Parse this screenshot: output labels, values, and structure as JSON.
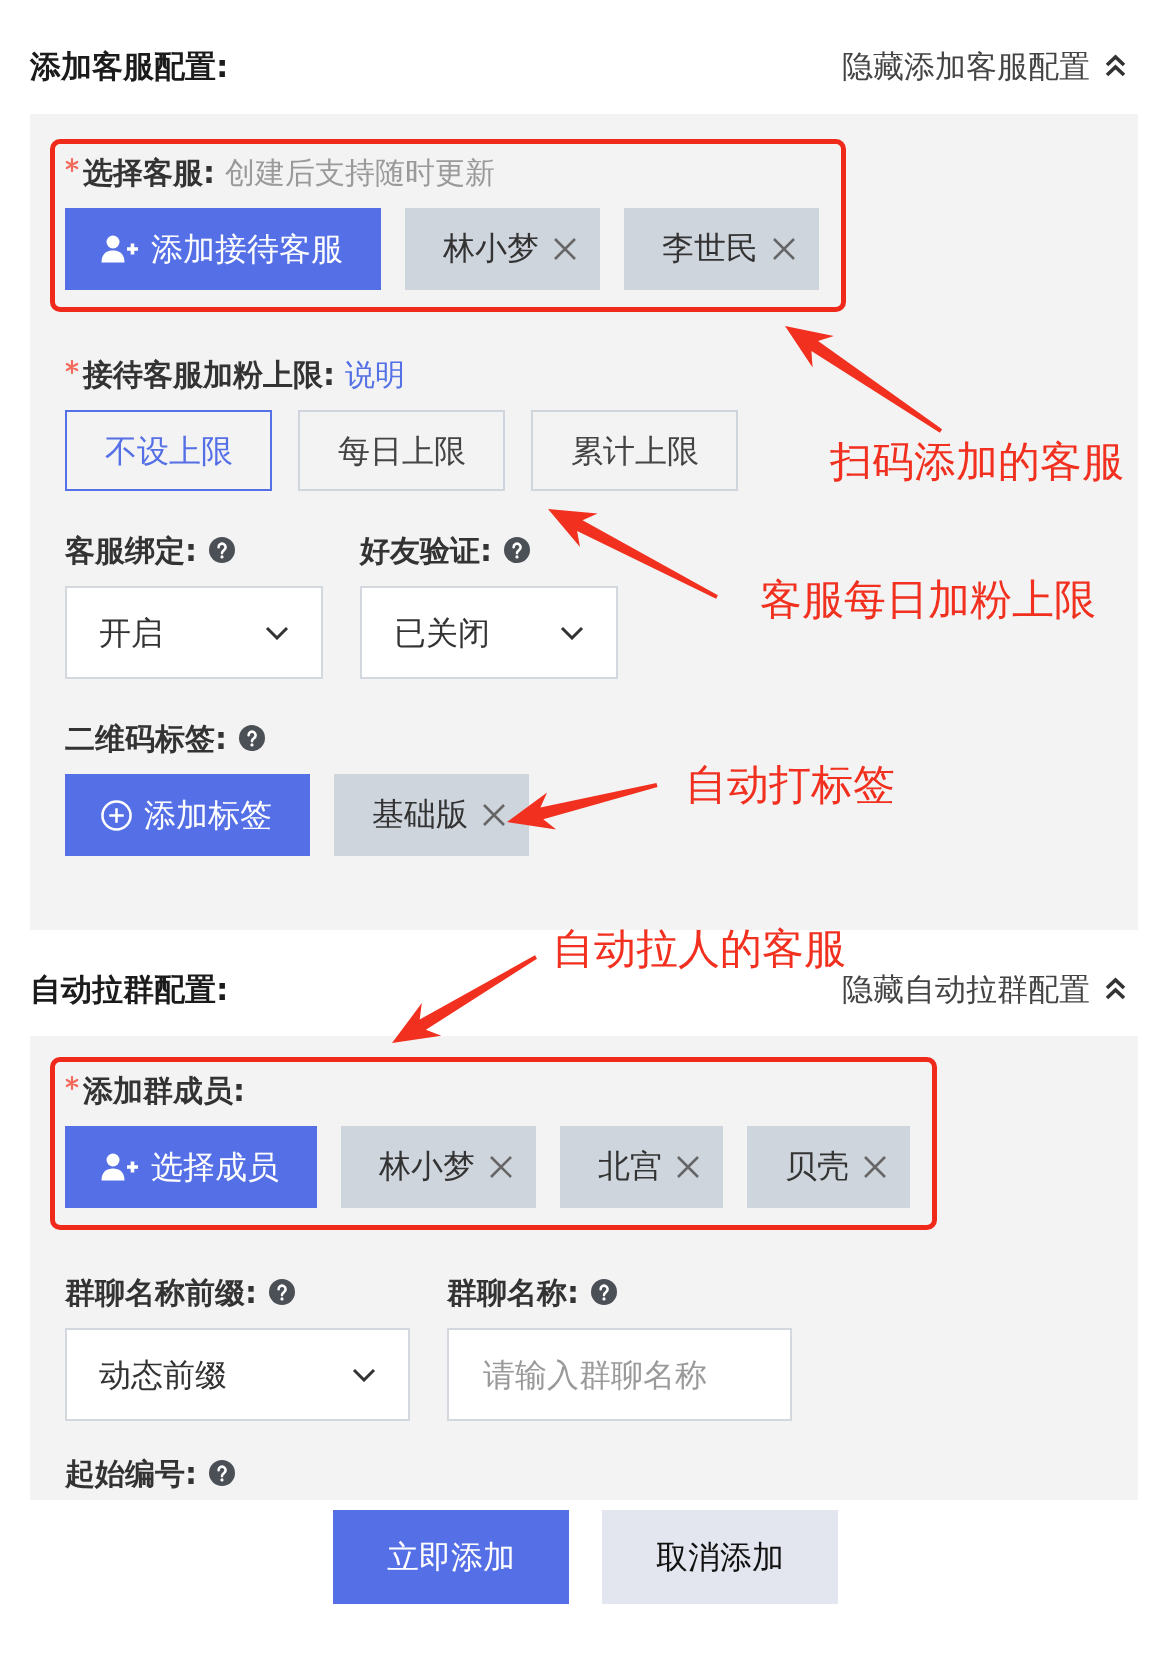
{
  "sections": [
    {
      "title": "添加客服配置:",
      "toggle": "隐藏添加客服配置",
      "fields": [
        {
          "kind": "people",
          "label": "选择客服:",
          "hint": "创建后支持随时更新",
          "required": true,
          "help": false,
          "highlighted": true,
          "button": "添加接待客服",
          "tags": [
            "林小梦",
            "李世民"
          ]
        },
        {
          "kind": "options",
          "label": "接待客服加粉上限:",
          "link": "说明",
          "required": true,
          "help": false,
          "highlighted": false,
          "options": [
            {
              "label": "不设上限",
              "selected": true
            },
            {
              "label": "每日上限",
              "selected": false
            },
            {
              "label": "累计上限",
              "selected": false
            }
          ]
        },
        {
          "kind": "row",
          "items": [
            {
              "kind": "select",
              "label": "客服绑定:",
              "help": true,
              "value": "开启"
            },
            {
              "kind": "select",
              "label": "好友验证:",
              "help": true,
              "value": "已关闭"
            }
          ]
        },
        {
          "kind": "tags",
          "label": "二维码标签:",
          "required": false,
          "help": true,
          "highlighted": false,
          "button": "添加标签",
          "tags": [
            "基础版"
          ]
        }
      ]
    },
    {
      "title": "自动拉群配置:",
      "toggle": "隐藏自动拉群配置",
      "fields": [
        {
          "kind": "people",
          "label": "添加群成员:",
          "required": true,
          "help": false,
          "highlighted": true,
          "button": "选择成员",
          "tags": [
            "林小梦",
            "北宫",
            "贝壳"
          ]
        },
        {
          "kind": "row",
          "items": [
            {
              "kind": "select",
              "label": "群聊名称前缀:",
              "help": true,
              "value": "动态前缀"
            },
            {
              "kind": "input",
              "label": "群聊名称:",
              "help": true,
              "placeholder": "请输入群聊名称"
            }
          ]
        },
        {
          "kind": "label",
          "label": "起始编号:",
          "required": false,
          "help": true,
          "highlighted": false
        }
      ]
    }
  ],
  "actions": [
    {
      "kind": "primary",
      "label": "立即添加"
    },
    {
      "kind": "secondary",
      "label": "取消添加"
    }
  ],
  "annotations": [
    {
      "text": "扫码添加的客服"
    },
    {
      "text": "客服每日加粉上限"
    },
    {
      "text": "自动打标签"
    },
    {
      "text": "自动拉人的客服"
    }
  ]
}
